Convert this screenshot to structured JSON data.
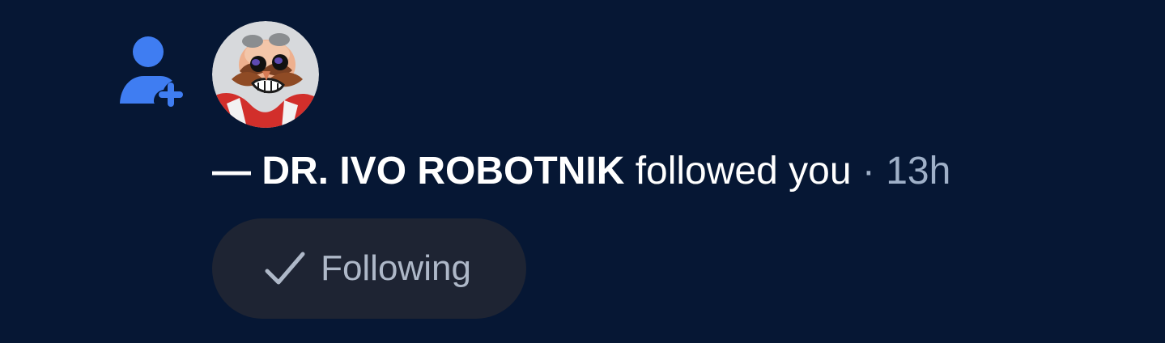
{
  "notification": {
    "type_icon": "follow-user-plus-icon",
    "avatar_icon": "profile-avatar",
    "prefix": "— ",
    "actor_name": "DR. IVO ROBOTNIK",
    "action": " followed you",
    "separator": " · ",
    "time": "13h",
    "button": {
      "icon": "check-icon",
      "label": "Following"
    }
  },
  "colors": {
    "background": "#061734",
    "accent": "#3f7df2",
    "text_primary": "#ffffff",
    "text_secondary": "#9fb0c8",
    "button_background": "#1e2433"
  }
}
